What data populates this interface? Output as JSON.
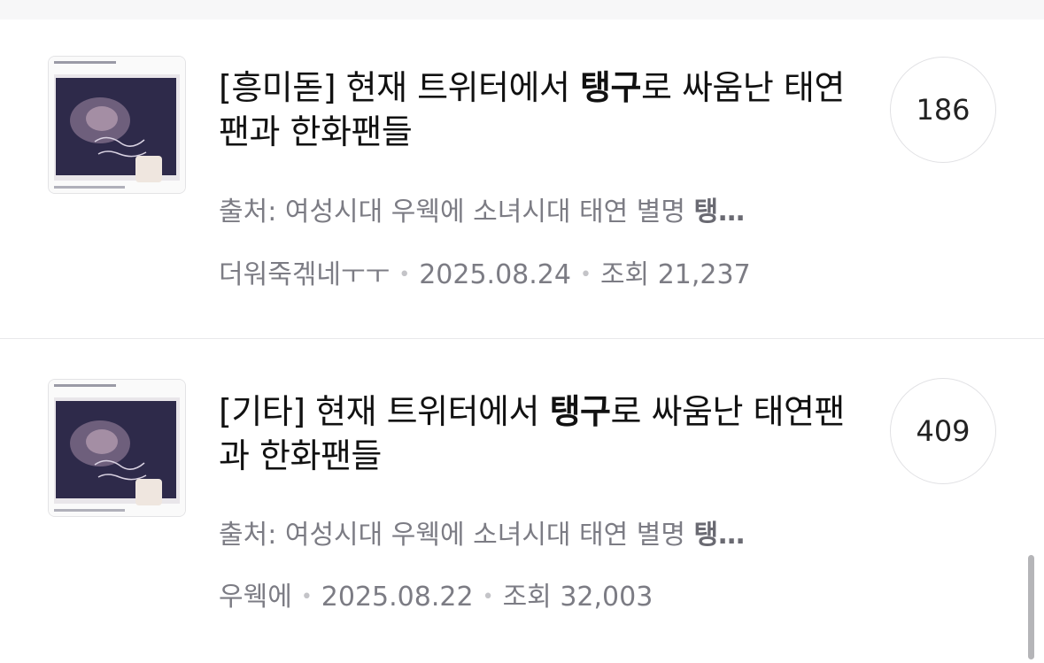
{
  "posts": [
    {
      "category": "[흥미돋]",
      "title_pre": "현재 트위터에서 ",
      "title_highlight": "탱구",
      "title_post": "로 싸움난 태연팬과 한화팬들",
      "snippet_pre": "출처: 여성시대 우웩에 소녀시대 태연 별명 ",
      "snippet_highlight": "탱…",
      "author": "더워죽겎네ㅜㅜ",
      "date": "2025.08.24",
      "views_label": "조회",
      "views": "21,237",
      "comment_count": "186"
    },
    {
      "category": "[기타]",
      "title_pre": "현재 트위터에서 ",
      "title_highlight": "탱구",
      "title_post": "로 싸움난 태연팬과 한화팬들",
      "snippet_pre": "출처: 여성시대 우웩에 소녀시대 태연 별명 ",
      "snippet_highlight": "탱…",
      "author": "우웩에",
      "date": "2025.08.22",
      "views_label": "조회",
      "views": "32,003",
      "comment_count": "409"
    }
  ]
}
